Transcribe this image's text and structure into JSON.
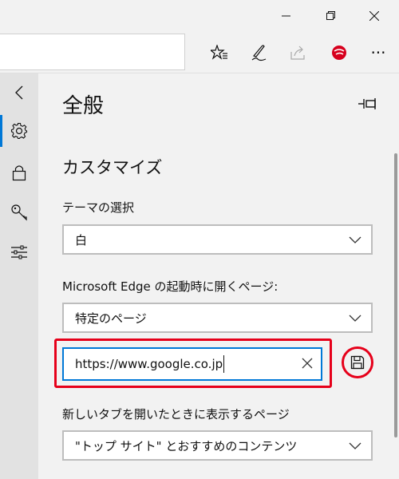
{
  "window": {
    "controls": [
      "minimize",
      "restore",
      "close"
    ]
  },
  "toolbar": {
    "icons": [
      "favorites-icon",
      "notes-pen-icon",
      "share-icon",
      "trend-micro-icon",
      "more-icon"
    ],
    "more_glyph": "···"
  },
  "sidebar": {
    "items": [
      "back-icon",
      "gear-icon",
      "lock-icon",
      "key-icon",
      "sliders-icon"
    ],
    "active": "gear-icon"
  },
  "panel": {
    "title": "全般",
    "section": "カスタマイズ",
    "theme_label": "テーマの選択",
    "theme_value": "白",
    "startup_label": "Microsoft Edge の起動時に開くページ:",
    "startup_value": "特定のページ",
    "url_value": "https://www.google.co.jp",
    "newtab_label": "新しいタブを開いたときに表示するページ",
    "newtab_value": "\"トップ サイト\" とおすすめのコンテンツ"
  },
  "colors": {
    "accent": "#0078d7",
    "highlight": "#e6001a",
    "trend_micro": "#d7001d"
  }
}
